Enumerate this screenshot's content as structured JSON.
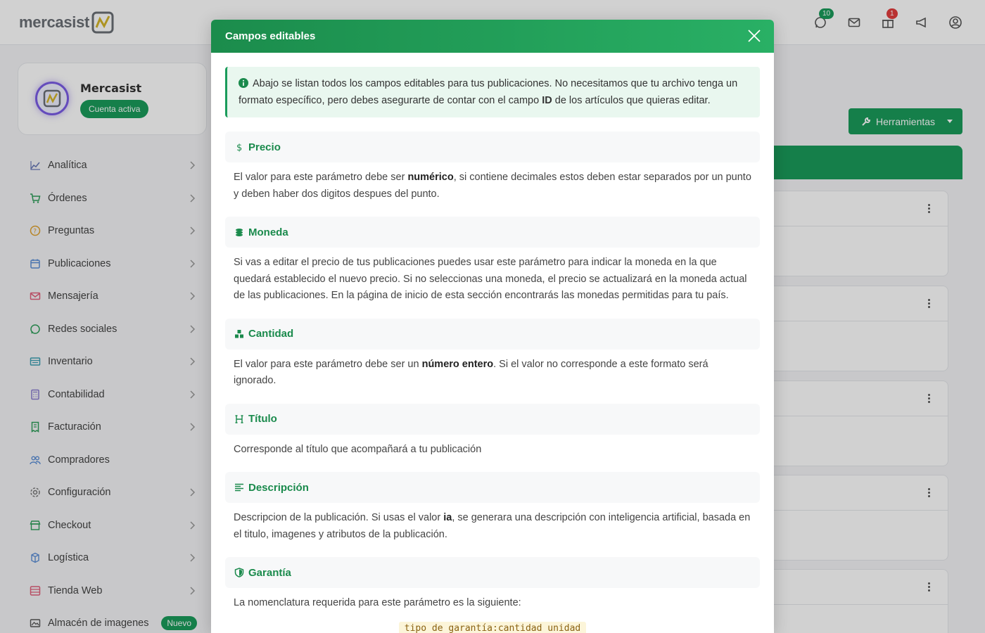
{
  "app": {
    "logo_text": "mercasist",
    "top_badges": {
      "whatsapp": "10",
      "gift": "1"
    }
  },
  "profile": {
    "name": "Mercasist",
    "status": "Cuenta activa"
  },
  "sidebar": {
    "items": [
      {
        "label": "Analítica",
        "icon": "chart-line-icon",
        "chevron": true
      },
      {
        "label": "Órdenes",
        "icon": "cart-icon",
        "chevron": true
      },
      {
        "label": "Preguntas",
        "icon": "question-icon",
        "chevron": true
      },
      {
        "label": "Publicaciones",
        "icon": "calendar-icon",
        "chevron": true
      },
      {
        "label": "Mensajería",
        "icon": "envelope-icon",
        "chevron": true
      },
      {
        "label": "Redes sociales",
        "icon": "whatsapp-icon",
        "chevron": true
      },
      {
        "label": "Inventario",
        "icon": "box-icon",
        "chevron": true
      },
      {
        "label": "Contabilidad",
        "icon": "calculator-icon",
        "chevron": true
      },
      {
        "label": "Facturación",
        "icon": "receipt-icon",
        "chevron": true
      },
      {
        "label": "Compradores",
        "icon": "users-icon",
        "chevron": false
      },
      {
        "label": "Configuración",
        "icon": "gear-icon",
        "chevron": true
      },
      {
        "label": "Checkout",
        "icon": "store-icon",
        "chevron": true
      },
      {
        "label": "Logística",
        "icon": "truck-icon",
        "chevron": true
      },
      {
        "label": "Tienda Web",
        "icon": "shop-icon",
        "chevron": true
      },
      {
        "label": "Almacén de imagenes",
        "icon": "images-icon",
        "badge": "Nuevo"
      }
    ]
  },
  "toolbar": {
    "tools_label": "Herramientas"
  },
  "modal": {
    "title": "Campos editables",
    "info_pre": "Abajo se listan todos los campos editables para tus publicaciones. No necesitamos que tu archivo tenga un formato específico, pero debes asegurarte de contar con el campo ",
    "info_bold": "ID",
    "info_post": " de los artículos que quieras editar.",
    "sections": {
      "precio": {
        "title": "Precio",
        "pre": "El valor para este parámetro debe ser ",
        "bold": "numérico",
        "post": ", si contiene decimales estos deben estar separados por un punto y deben haber dos digitos despues del punto."
      },
      "moneda": {
        "title": "Moneda",
        "text": "Si vas a editar el precio de tus publicaciones puedes usar este parámetro para indicar la moneda en la que quedará establecido el nuevo precio. Si no seleccionas una moneda, el precio se actualizará en la moneda actual de las publicaciones. En la página de inicio de esta sección encontrarás las monedas permitidas para tu país."
      },
      "cantidad": {
        "title": "Cantidad",
        "pre": "El valor para este parámetro debe ser un ",
        "bold": "número entero",
        "post": ". Si el valor no corresponde a este formato será ignorado."
      },
      "titulo": {
        "title": "Título",
        "text": "Corresponde al título que acompañará a tu publicación"
      },
      "descripcion": {
        "title": "Descripción",
        "pre": "Descripcion de la publicación. Si usas el valor ",
        "bold": "ia",
        "post": ", se generara una descripción con inteligencia artificial, basada en el titulo, imagenes y atributos de la publicación."
      },
      "garantia": {
        "title": "Garantía",
        "text": "La nomenclatura requerida para este parámetro es la siguiente:",
        "code": "tipo de garantía:cantidad unidad"
      }
    }
  }
}
